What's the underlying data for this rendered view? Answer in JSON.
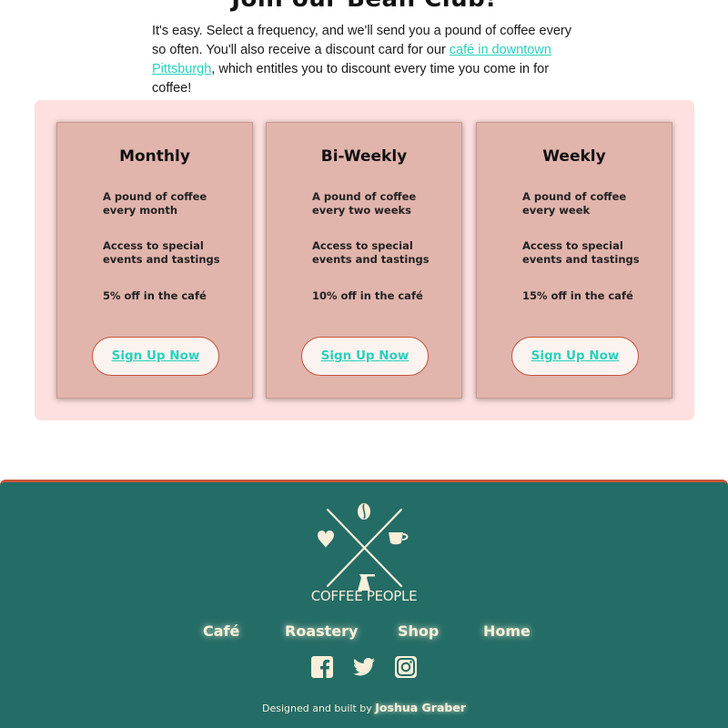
{
  "page": {
    "heading": "Join our Bean Club!",
    "intro_before": "It's easy. Select a frequency, and we'll send you a pound of coffee every so often. You'll also receive a discount card for our ",
    "intro_link": "café in downtown Pittsburgh",
    "intro_after": ", which entitles you to discount every time you come in for coffee!",
    "link_color": "#2ad1bd"
  },
  "plans": [
    {
      "title": "Monthly",
      "features": [
        "A pound of coffee every month",
        "Access to special events and tastings",
        "5% off in the café"
      ],
      "button": "Sign Up Now"
    },
    {
      "title": "Bi-Weekly",
      "features": [
        "A pound of coffee every two weeks",
        "Access to special events and tastings",
        "10% off in the café"
      ],
      "button": "Sign Up Now"
    },
    {
      "title": "Weekly",
      "features": [
        "A pound of coffee every week",
        "Access to special events and tastings",
        "15% off in the café"
      ],
      "button": "Sign Up Now"
    }
  ],
  "footer": {
    "logo_text": "COFFEE PEOPLE",
    "nav": [
      "Café",
      "Roastery",
      "Shop",
      "Home"
    ],
    "social": [
      "facebook-icon",
      "twitter-icon",
      "instagram-icon"
    ],
    "credit_prefix": "Designed and built by",
    "credit_author": "Joshua Graber",
    "background": "#246c66",
    "accent": "#c9553a"
  }
}
